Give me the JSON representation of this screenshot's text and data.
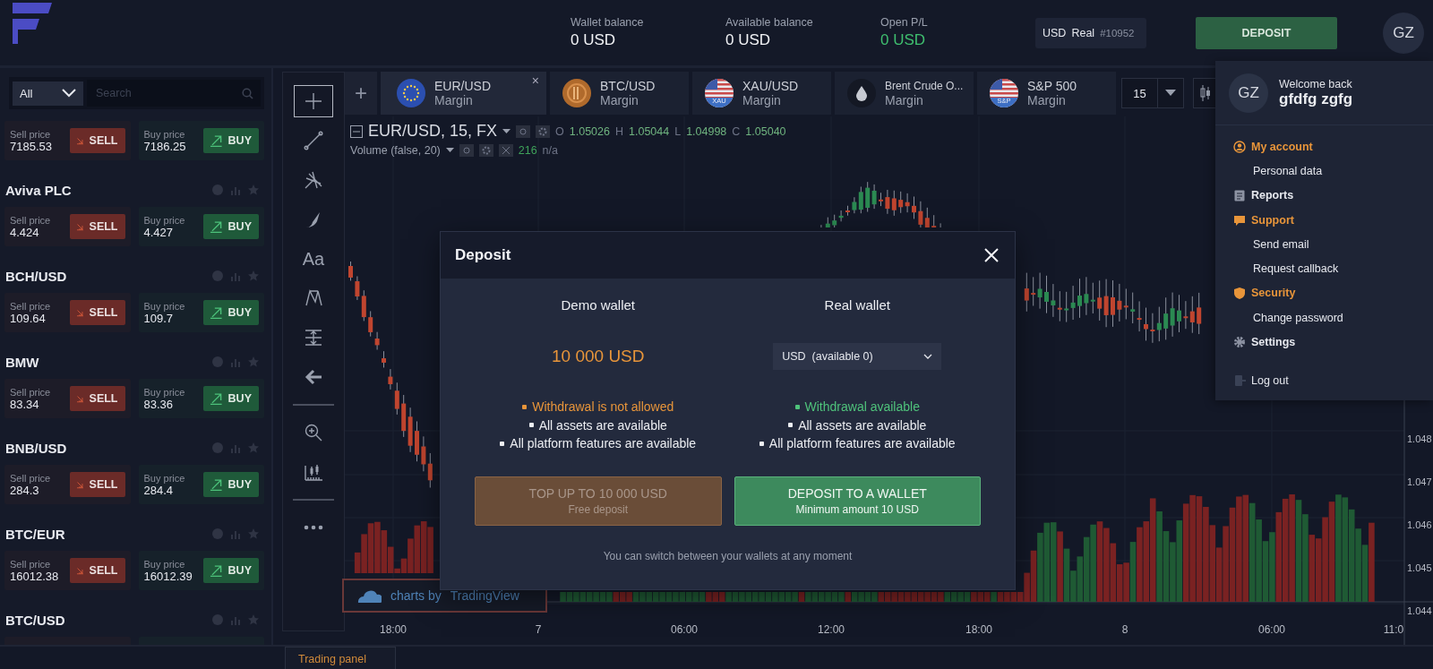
{
  "header": {
    "stats": [
      {
        "kind": "neutral",
        "label": "Wallet balance",
        "value": "0 USD"
      },
      {
        "kind": "neutral",
        "label": "Available balance",
        "value": "0 USD"
      },
      {
        "kind": "positive",
        "label": "Open P/L",
        "value": "0 USD"
      }
    ],
    "account_selector": {
      "currency": "USD",
      "type": "Real",
      "number": "#10952"
    },
    "deposit_button": "DEPOSIT",
    "avatar": "GZ"
  },
  "asset_list": {
    "filter": "All",
    "search": {
      "placeholder": "Search"
    },
    "assets": [
      {
        "sell_label": "Sell price",
        "sell_price": "7185.53",
        "sell_button": "SELL",
        "buy_label": "Buy price",
        "buy_price": "7186.25",
        "buy_button": "BUY"
      },
      {
        "name": "Aviva PLC",
        "sell_label": "Sell price",
        "sell_price": "4.424",
        "sell_button": "SELL",
        "buy_label": "Buy price",
        "buy_price": "4.427",
        "buy_button": "BUY"
      },
      {
        "name": "BCH/USD",
        "sell_label": "Sell price",
        "sell_price": "109.64",
        "sell_button": "SELL",
        "buy_label": "Buy price",
        "buy_price": "109.7",
        "buy_button": "BUY"
      },
      {
        "name": "BMW",
        "sell_label": "Sell price",
        "sell_price": "83.34",
        "sell_button": "SELL",
        "buy_label": "Buy price",
        "buy_price": "83.36",
        "buy_button": "BUY"
      },
      {
        "name": "BNB/USD",
        "sell_label": "Sell price",
        "sell_price": "284.3",
        "sell_button": "SELL",
        "buy_label": "Buy price",
        "buy_price": "284.4",
        "buy_button": "BUY"
      },
      {
        "name": "BTC/EUR",
        "sell_label": "Sell price",
        "sell_price": "16012.38",
        "sell_button": "SELL",
        "buy_label": "Buy price",
        "buy_price": "16012.39",
        "buy_button": "BUY"
      },
      {
        "name": "BTC/USD"
      }
    ]
  },
  "chart": {
    "tools": [
      {
        "kind": "crosshair",
        "selected": true
      },
      {
        "kind": "trend_line",
        "selected": false
      },
      {
        "kind": "pitchfork",
        "selected": false
      },
      {
        "kind": "brush",
        "selected": false
      },
      {
        "kind": "text",
        "label": "Aa",
        "selected": false
      },
      {
        "kind": "pattern",
        "selected": false
      },
      {
        "kind": "measure",
        "selected": false
      },
      {
        "kind": "arrow",
        "selected": false
      },
      {
        "kind": "separator"
      },
      {
        "kind": "zoom",
        "selected": false
      },
      {
        "kind": "ruler",
        "selected": false
      },
      {
        "kind": "separator"
      },
      {
        "kind": "more",
        "selected": false
      }
    ],
    "add_tab": "+",
    "tabs": [
      {
        "kind": "eu_flag",
        "symbol": "EUR/USD",
        "type": "Margin",
        "selected": true,
        "close": "×"
      },
      {
        "kind": "coin",
        "symbol": "BTC/USD",
        "type": "Margin",
        "selected": false
      },
      {
        "kind": "us_flag",
        "icon_label": "XAU",
        "symbol": "XAU/USD",
        "type": "Margin",
        "selected": false
      },
      {
        "kind": "drop",
        "symbol": "Brent Crude O...",
        "type": "Margin",
        "selected": false
      },
      {
        "kind": "us_flag",
        "icon_label": "S&P",
        "symbol": "S&P 500",
        "type": "Margin",
        "selected": false
      }
    ],
    "interval": "15",
    "legend": {
      "title": "EUR/USD, 15, FX",
      "ohlc": [
        {
          "key": "O",
          "value": "1.05026"
        },
        {
          "key": "H",
          "value": "1.05044"
        },
        {
          "key": "L",
          "value": "1.04998"
        },
        {
          "key": "C",
          "value": "1.05040"
        }
      ],
      "volume": "Volume (false, 20)",
      "volume_value": "216",
      "volume_extra": "n/a"
    },
    "x_axis_labels": [
      "18:00",
      "7",
      "06:00",
      "12:00",
      "18:00",
      "8",
      "06:00",
      "11:0"
    ],
    "y_axis_labels": [
      "1.048",
      "1.047",
      "1.046",
      "1.045",
      "1.044"
    ],
    "attribution": {
      "prefix": "charts by",
      "link": "TradingView"
    }
  },
  "bottom_bar": {
    "tab": "Trading panel"
  },
  "deposit_modal": {
    "title": "Deposit",
    "wallets": [
      {
        "kind": "demo",
        "title": "Demo wallet",
        "amount": "10 000 USD",
        "features": [
          {
            "color": "#e8953a",
            "text": "Withdrawal is not allowed"
          },
          {
            "color": "#eceef2",
            "text": "All assets are available"
          },
          {
            "color": "#eceef2",
            "text": "All platform features are available"
          }
        ],
        "button": {
          "label": "TOP UP TO 10 000 USD",
          "sublabel": "Free deposit",
          "disabled": true
        }
      },
      {
        "kind": "real",
        "title": "Real wallet",
        "wallet_select": "USD  (available 0)",
        "features": [
          {
            "color": "#4fc27b",
            "text": "Withdrawal available"
          },
          {
            "color": "#eceef2",
            "text": "All assets are available"
          },
          {
            "color": "#eceef2",
            "text": "All platform features are available"
          }
        ],
        "button": {
          "label": "DEPOSIT TO A WALLET",
          "sublabel": "Minimum amount 10 USD",
          "disabled": false
        }
      }
    ],
    "note": "You can switch between your wallets at any moment"
  },
  "account_menu": {
    "avatar": "GZ",
    "greeting": "Welcome back",
    "user_name": "gfdfg zgfg",
    "items": [
      {
        "kind": "account",
        "label": "My account",
        "expanded": true,
        "children": [
          {
            "label": "Personal data"
          }
        ]
      },
      {
        "kind": "reports",
        "label": "Reports",
        "expanded": false
      },
      {
        "kind": "support",
        "label": "Support",
        "expanded": true,
        "children": [
          {
            "label": "Send email"
          },
          {
            "label": "Request callback"
          }
        ]
      },
      {
        "kind": "security",
        "label": "Security",
        "expanded": true,
        "children": [
          {
            "label": "Change password"
          }
        ]
      },
      {
        "kind": "settings",
        "label": "Settings",
        "expanded": false
      },
      {
        "kind": "logout",
        "label": "Log out",
        "expanded": false
      }
    ]
  }
}
